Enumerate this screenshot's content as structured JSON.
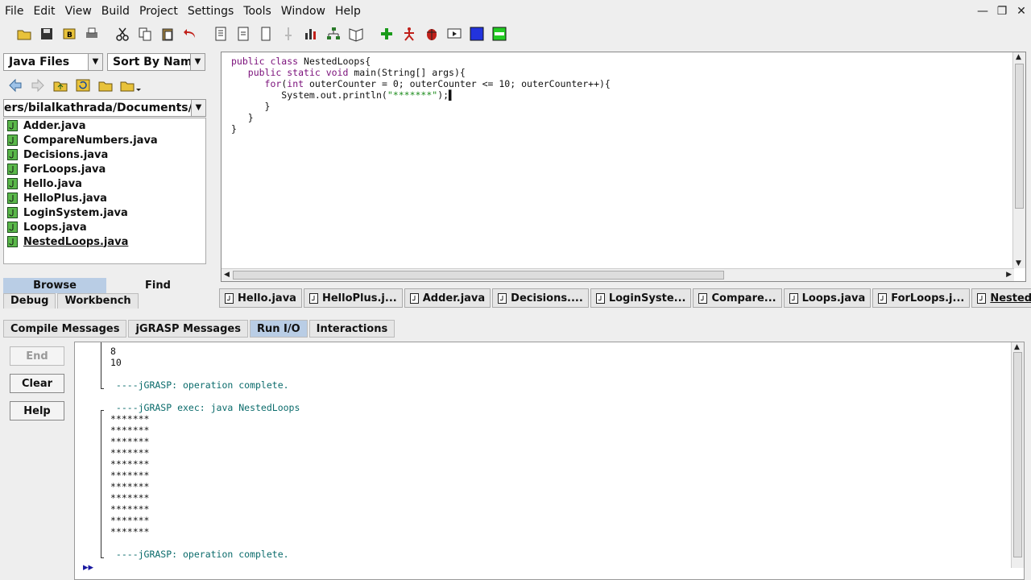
{
  "menu": [
    "File",
    "Edit",
    "View",
    "Build",
    "Project",
    "Settings",
    "Tools",
    "Window",
    "Help"
  ],
  "window_controls": [
    "minimize",
    "restore",
    "close"
  ],
  "toolbar_icons": [
    "open-folder-icon",
    "save-icon",
    "save-all-icon",
    "print-icon",
    "cut-icon",
    "copy-icon",
    "paste-icon",
    "undo-icon",
    "page-icon",
    "page2-icon",
    "page3-icon",
    "pin-icon",
    "chart-icon",
    "tree-icon",
    "book-icon",
    "add-icon",
    "run-icon",
    "debug-icon",
    "step-icon",
    "blue-square-icon",
    "green-panel-icon"
  ],
  "left": {
    "file_type": "Java Files",
    "sort_by": "Sort By Name",
    "path": "ers/bilalkathrada/Documents/java",
    "files": [
      "Adder.java",
      "CompareNumbers.java",
      "Decisions.java",
      "ForLoops.java",
      "Hello.java",
      "HelloPlus.java",
      "LoginSystem.java",
      "Loops.java",
      "NestedLoops.java"
    ],
    "selected_file": "NestedLoops.java",
    "browse_tab": "Browse",
    "find_tab": "Find",
    "debug_tab": "Debug",
    "workbench_tab": "Workbench"
  },
  "editor": {
    "lines": [
      "public class NestedLoops{",
      "   public static void main(String[] args){",
      "      for(int outerCounter = 0; outerCounter <= 10; outerCounter++){",
      "         System.out.println(\"*******\");",
      "      }",
      "   }",
      "}"
    ],
    "tabs": [
      "Hello.java",
      "HelloPlus.j...",
      "Adder.java",
      "Decisions....",
      "LoginSyste...",
      "Compare...",
      "Loops.java",
      "ForLoops.j...",
      "NestedLo..."
    ],
    "active_tab": "NestedLo..."
  },
  "bottom": {
    "tabs": [
      "Compile Messages",
      "jGRASP Messages",
      "Run I/O",
      "Interactions"
    ],
    "active_tab": "Run I/O",
    "buttons": {
      "end": "End",
      "clear": "Clear",
      "help": "Help"
    },
    "console": {
      "prev_output": [
        "8",
        "10"
      ],
      "complete_msg_1": " ----jGRASP: operation complete.",
      "exec_msg": " ----jGRASP exec: java NestedLoops",
      "output": [
        "*******",
        "*******",
        "*******",
        "*******",
        "*******",
        "*******",
        "*******",
        "*******",
        "*******",
        "*******",
        "*******"
      ],
      "complete_msg_2": " ----jGRASP: operation complete.",
      "prompt": "▸▸"
    }
  },
  "colors": {
    "keyword": "#7a0f7a",
    "string": "#1a8a1a",
    "console_msg": "#0a6b6b",
    "active_tab": "#b9cde5"
  }
}
